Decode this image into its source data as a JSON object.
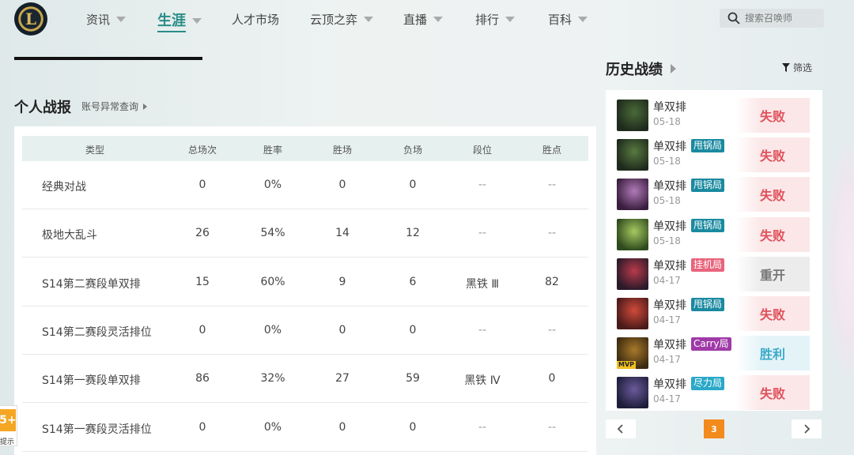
{
  "nav": {
    "logo_text": "L",
    "items": [
      {
        "label": "资讯",
        "caret": true,
        "active": false
      },
      {
        "label": "生涯",
        "caret": true,
        "active": true
      },
      {
        "label": "人才市场",
        "caret": false,
        "active": false
      },
      {
        "label": "云顶之弈",
        "caret": true,
        "active": false
      },
      {
        "label": "直播",
        "caret": true,
        "active": false
      },
      {
        "label": "排行",
        "caret": true,
        "active": false
      },
      {
        "label": "百科",
        "caret": true,
        "active": false
      }
    ],
    "search_placeholder": "搜索召唤师"
  },
  "report": {
    "title": "个人战报",
    "link": "账号异常查询",
    "headers": [
      "类型",
      "总场次",
      "胜率",
      "胜场",
      "负场",
      "段位",
      "胜点"
    ],
    "rows": [
      [
        "经典对战",
        "0",
        "0%",
        "0",
        "0",
        "--",
        "--"
      ],
      [
        "极地大乱斗",
        "26",
        "54%",
        "14",
        "12",
        "--",
        "--"
      ],
      [
        "S14第二赛段单双排",
        "15",
        "60%",
        "9",
        "6",
        "黑铁 Ⅲ",
        "82"
      ],
      [
        "S14第二赛段灵活排位",
        "0",
        "0%",
        "0",
        "0",
        "--",
        "--"
      ],
      [
        "S14第一赛段单双排",
        "86",
        "32%",
        "27",
        "59",
        "黑铁 Ⅳ",
        "0"
      ],
      [
        "S14第一赛段灵活排位",
        "0",
        "0%",
        "0",
        "0",
        "--",
        "--"
      ]
    ]
  },
  "history": {
    "title": "历史战绩",
    "filter": "筛选",
    "matches": [
      {
        "mode": "单双排",
        "tag": "",
        "tag_color": "",
        "date": "05-18",
        "result": "失败",
        "kind": "lose",
        "avatar": [
          "#1e2a1c",
          "#4a6a38"
        ],
        "mvp": ""
      },
      {
        "mode": "单双排",
        "tag": "甩锅局",
        "tag_color": "#1a8aa0",
        "date": "05-18",
        "result": "失败",
        "kind": "lose",
        "avatar": [
          "#1e2a1c",
          "#587a40"
        ],
        "mvp": ""
      },
      {
        "mode": "单双排",
        "tag": "甩锅局",
        "tag_color": "#1a8aa0",
        "date": "05-18",
        "result": "失败",
        "kind": "lose",
        "avatar": [
          "#3a1e3e",
          "#b07ab8"
        ],
        "mvp": ""
      },
      {
        "mode": "单双排",
        "tag": "甩锅局",
        "tag_color": "#1a8aa0",
        "date": "05-18",
        "result": "失败",
        "kind": "lose",
        "avatar": [
          "#2e4a1e",
          "#a8c860"
        ],
        "mvp": ""
      },
      {
        "mode": "单双排",
        "tag": "挂机局",
        "tag_color": "#e8647c",
        "date": "04-17",
        "result": "重开",
        "kind": "remake",
        "avatar": [
          "#2a1a2a",
          "#b83a4a"
        ],
        "mvp": ""
      },
      {
        "mode": "单双排",
        "tag": "甩锅局",
        "tag_color": "#1a8aa0",
        "date": "04-17",
        "result": "失败",
        "kind": "lose",
        "avatar": [
          "#4a1a1a",
          "#d04a3a"
        ],
        "mvp": ""
      },
      {
        "mode": "单双排",
        "tag": "Carry局",
        "tag_color": "#a03aa8",
        "date": "04-17",
        "result": "胜利",
        "kind": "win",
        "avatar": [
          "#3a2a10",
          "#a8782a"
        ],
        "mvp": "MVP"
      },
      {
        "mode": "单双排",
        "tag": "尽力局",
        "tag_color": "#2aa8c8",
        "date": "04-17",
        "result": "失败",
        "kind": "lose",
        "avatar": [
          "#1e1e3a",
          "#6a5a9a"
        ],
        "mvp": ""
      }
    ],
    "page": "3"
  },
  "side_badge": {
    "number": "5+",
    "text": "提示"
  }
}
